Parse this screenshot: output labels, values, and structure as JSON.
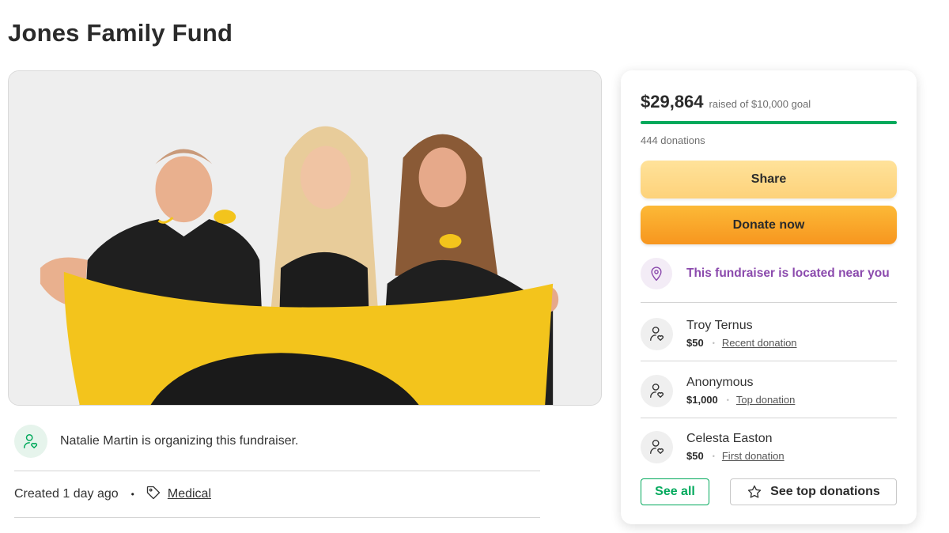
{
  "page": {
    "title": "Jones Family Fund"
  },
  "organizer": {
    "text": "Natalie Martin is organizing this fundraiser.",
    "icon": "user-heart-icon"
  },
  "meta": {
    "created": "Created 1 day ago",
    "dot": "•",
    "category": "Medical",
    "category_icon": "tag-icon"
  },
  "card": {
    "amount_raised": "$29,864",
    "goal_text": "raised of $10,000 goal",
    "progress_fraction": 1.0,
    "donation_count": "444 donations",
    "share_label": "Share",
    "donate_label": "Donate now",
    "location_text": "This fundraiser is located near you",
    "location_icon": "location-pin-icon",
    "donations": [
      {
        "name": "Troy Ternus",
        "amount": "$50",
        "type": "Recent donation"
      },
      {
        "name": "Anonymous",
        "amount": "$1,000",
        "type": "Top donation"
      },
      {
        "name": "Celesta Easton",
        "amount": "$50",
        "type": "First donation"
      }
    ],
    "separator": "•",
    "see_all_label": "See all",
    "see_top_label": "See top donations",
    "see_top_icon": "star-icon"
  },
  "colors": {
    "brand_green": "#02a95c",
    "share_yellow": "#fdd27a",
    "donate_orange": "#f7961f",
    "location_purple": "#8b4aad"
  }
}
